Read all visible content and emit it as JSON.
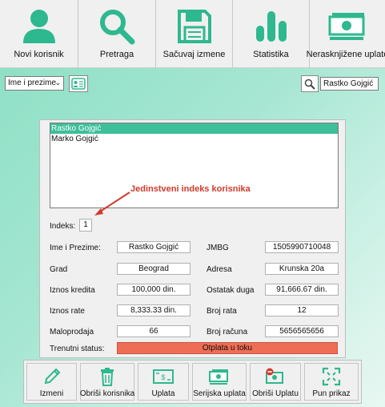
{
  "toolbar": {
    "buttons": [
      {
        "label": "Novi korisnik",
        "icon": "user-icon"
      },
      {
        "label": "Pretraga",
        "icon": "search-icon"
      },
      {
        "label": "Sačuvaj izmene",
        "icon": "save-icon"
      },
      {
        "label": "Statistika",
        "icon": "bar-chart-icon"
      },
      {
        "label": "Nerasknjižene uplate",
        "icon": "money-icon"
      }
    ]
  },
  "filter": {
    "combo_value": "Ime i prezime",
    "search_value": "Rastko Gojgić"
  },
  "users": [
    "Rastko Gojgić",
    "Marko Gojgić"
  ],
  "selected_user": "Rastko Gojgić",
  "annotation": "Jedinstveni indeks korisnika",
  "details": {
    "index_label": "Indeks:",
    "index_value": "1",
    "name_label": "Ime i Prezime:",
    "name_value": "Rastko Gojgić",
    "jmbg_label": "JMBG",
    "jmbg_value": "1505990710048",
    "city_label": "Grad",
    "city_value": "Beograd",
    "address_label": "Adresa",
    "address_value": "Krunska 20a",
    "loan_label": "Iznos kredita",
    "loan_value": "100,000 din.",
    "rest_label": "Ostatak duga",
    "rest_value": "91,666.67 din.",
    "rate_label": "Iznos rate",
    "rate_value": "8,333.33 din.",
    "rates_count_label": "Broj rata",
    "rates_count_value": "12",
    "store_label": "Maloprodaja",
    "store_value": "66",
    "account_label": "Broj računa",
    "account_value": "5656565656",
    "status_label": "Trenutni status:",
    "status_value": "Otplata u toku"
  },
  "bottom": {
    "buttons": [
      {
        "label": "Izmeni",
        "icon": "pencil-icon"
      },
      {
        "label": "Obriši korisnika",
        "icon": "trash-icon"
      },
      {
        "label": "Uplata",
        "icon": "payment-icon"
      },
      {
        "label": "Serijska uplata",
        "icon": "money-stack-icon"
      },
      {
        "label": "Obriši Uplatu",
        "icon": "delete-payment-icon"
      },
      {
        "label": "Pun prikaz",
        "icon": "fullscreen-icon"
      }
    ]
  },
  "colors": {
    "accent": "#2eb88f",
    "status_bg": "#ee6e55",
    "annotation": "#d03a2c"
  }
}
